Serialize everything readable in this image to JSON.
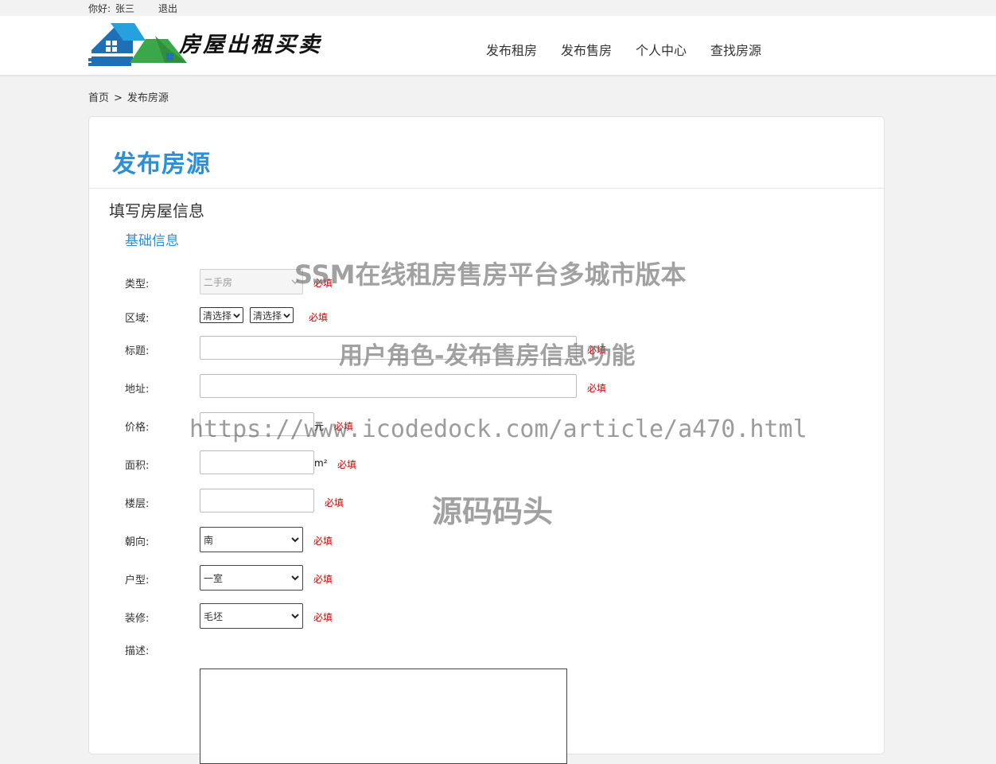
{
  "topbar": {
    "greeting": "你好:",
    "username": "张三",
    "logout": "退出"
  },
  "header": {
    "logo_text": "房屋出租买卖",
    "nav": [
      "发布租房",
      "发布售房",
      "个人中心",
      "查找房源"
    ]
  },
  "breadcrumb": {
    "home": "首页",
    "separator": ">",
    "current": "发布房源"
  },
  "panel": {
    "title": "发布房源",
    "section_title": "填写房屋信息",
    "subsection_title": "基础信息"
  },
  "form": {
    "required_text": "必填",
    "type": {
      "label": "类型:",
      "value": "二手房"
    },
    "region": {
      "label": "区域:",
      "select1": "清选择",
      "select2": "清选择"
    },
    "title": {
      "label": "标题:",
      "value": ""
    },
    "address": {
      "label": "地址:",
      "value": ""
    },
    "price": {
      "label": "价格:",
      "value": "",
      "unit": "元"
    },
    "area": {
      "label": "面积:",
      "value": "",
      "unit": "m²"
    },
    "floor": {
      "label": "楼层:",
      "value": ""
    },
    "orientation": {
      "label": "朝向:",
      "value": "南"
    },
    "layout": {
      "label": "户型:",
      "value": "一室"
    },
    "decoration": {
      "label": "装修:",
      "value": "毛坯"
    },
    "description": {
      "label": "描述:",
      "value": ""
    }
  },
  "watermarks": {
    "line1": "SSM在线租房售房平台多城市版本",
    "line2": "用户角色-发布售房信息功能",
    "line3": "https://www.icodedock.com/article/a470.html",
    "line4": "源码码头"
  },
  "colors": {
    "accent": "#2d8fd5",
    "required": "#cc0000",
    "logo_blue": "#1f6fb7",
    "logo_green": "#3aa84a"
  }
}
